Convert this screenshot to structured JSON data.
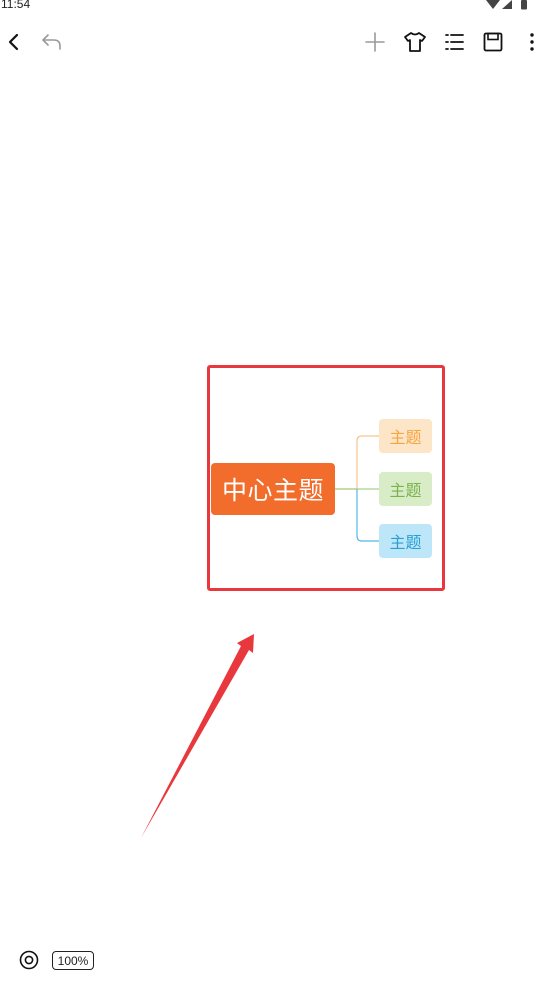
{
  "status_bar": {
    "time": "11:54"
  },
  "toolbar": {
    "back_icon": "chevron-left-icon",
    "undo_icon": "undo-icon",
    "add_icon": "plus-icon",
    "theme_icon": "tshirt-icon",
    "outline_icon": "list-icon",
    "save_icon": "save-icon",
    "more_icon": "more-vertical-icon"
  },
  "mindmap": {
    "central_topic": "中心主题",
    "central_color": "#f26c2b",
    "subtopics": [
      {
        "label": "主题",
        "bg": "#fde5c8",
        "text_color": "#f6a540",
        "line_color": "#f8c589"
      },
      {
        "label": "主题",
        "bg": "#d8ecc8",
        "text_color": "#7ab448",
        "line_color": "#a9d08a"
      },
      {
        "label": "主题",
        "bg": "#bde7f8",
        "text_color": "#2a9fd6",
        "line_color": "#52b8e4"
      }
    ]
  },
  "annotation": {
    "highlight_color": "#e8383d",
    "arrow_color": "#e8383d"
  },
  "bottom": {
    "locate_icon": "target-icon",
    "zoom": "100%"
  }
}
